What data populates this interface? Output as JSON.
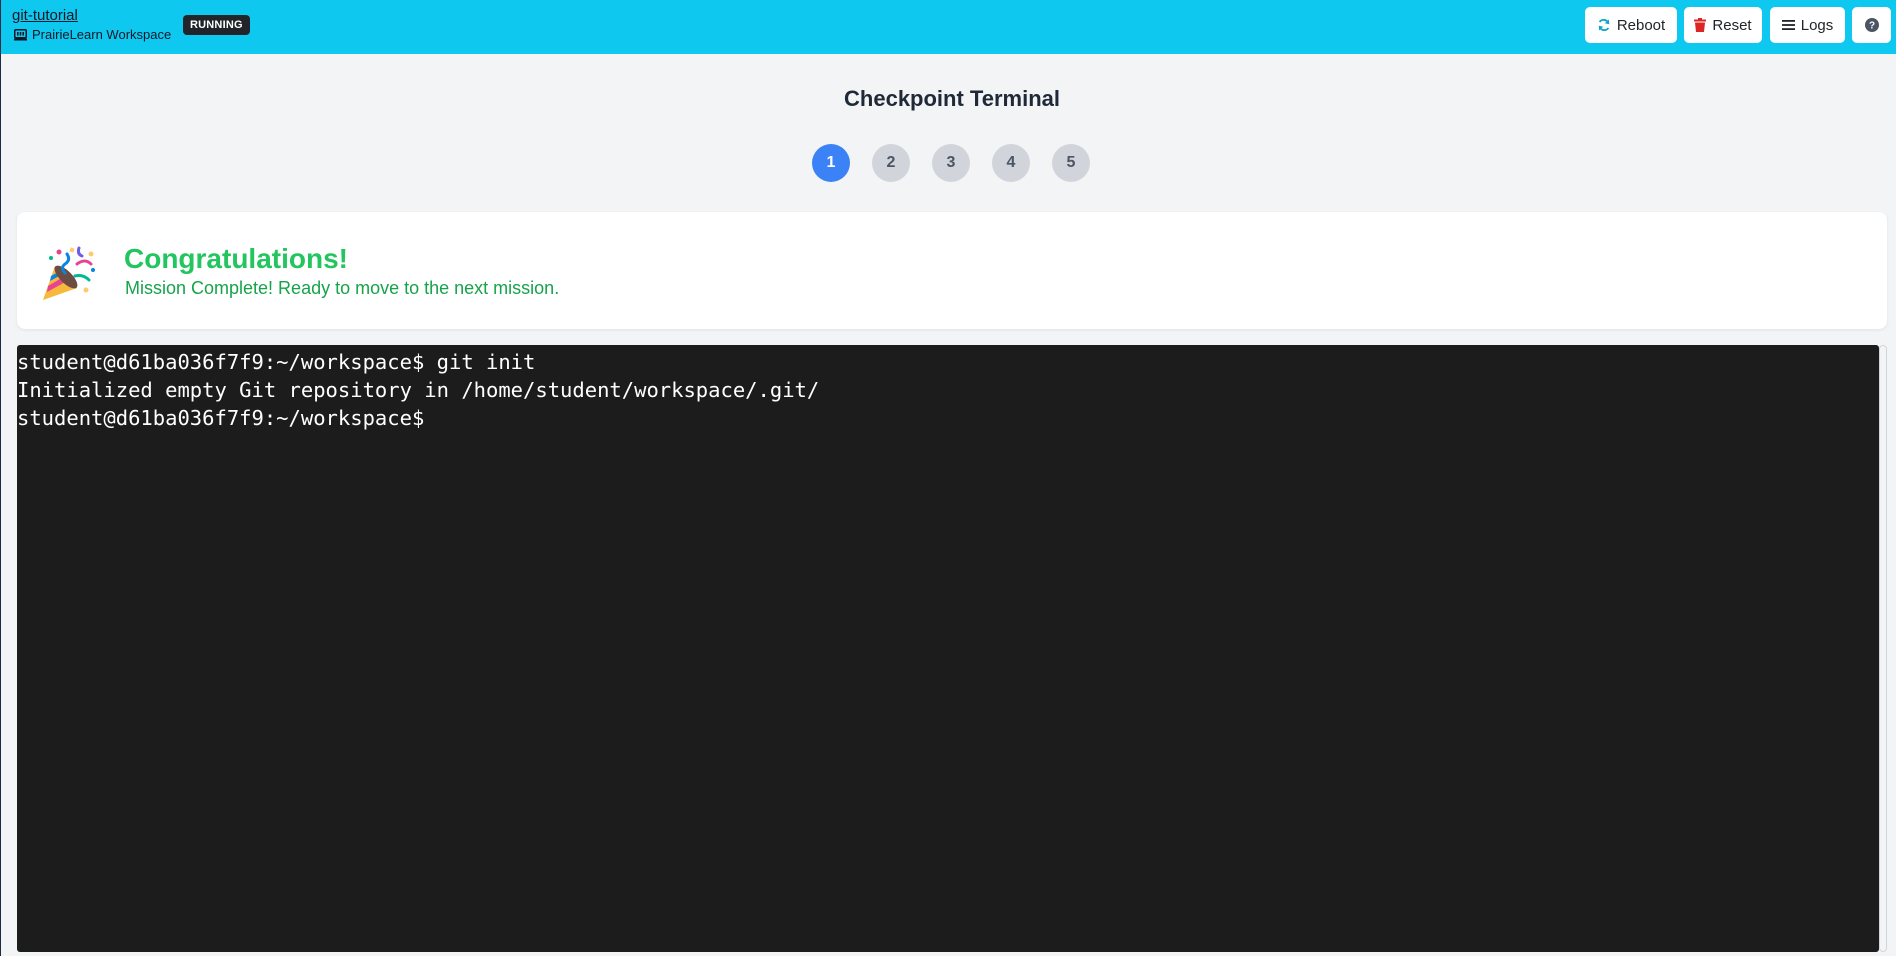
{
  "header": {
    "workspace_name": "git-tutorial",
    "workspace_subtitle": "PrairieLearn Workspace",
    "status": "RUNNING",
    "buttons": {
      "reboot": "Reboot",
      "reset": "Reset",
      "logs": "Logs"
    },
    "icons": {
      "subtitle": "workspace-icon",
      "reboot": "refresh-icon",
      "reset": "trash-icon",
      "logs": "list-icon",
      "help": "question-circle-icon"
    }
  },
  "main": {
    "title": "Checkpoint Terminal",
    "steps": [
      "1",
      "2",
      "3",
      "4",
      "5"
    ],
    "active_step": "1",
    "congrats": {
      "icon": "party-popper-icon",
      "title": "Congratulations!",
      "message": "Mission Complete! Ready to move to the next mission."
    }
  },
  "terminal": {
    "lines": [
      "student@d61ba036f7f9:~/workspace$ git init",
      "Initialized empty Git repository in /home/student/workspace/.git/",
      "student@d61ba036f7f9:~/workspace$ "
    ]
  },
  "colors": {
    "topbar": "#0ec8f0",
    "badge": "#212529",
    "active_step": "#3b82f6",
    "inactive_step": "#d1d5db",
    "congrats_title": "#22c55e",
    "congrats_message": "#16a34a",
    "reset_icon": "#dc2626",
    "reboot_icon": "#0ea5c6",
    "terminal_bg": "#1c1c1c"
  }
}
